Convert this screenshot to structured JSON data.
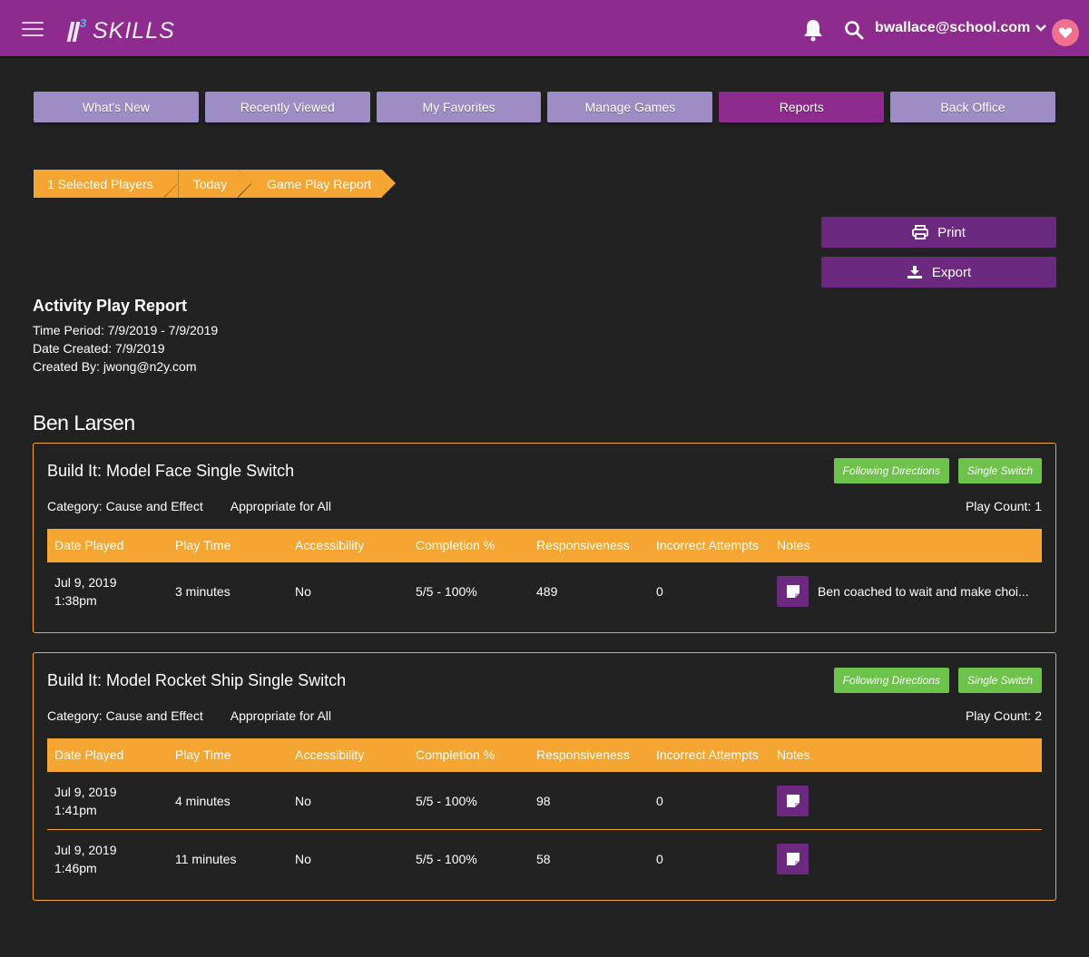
{
  "header": {
    "logo_superscript": "3",
    "logo_text": "SKILLS",
    "user_email": "bwallace@school.com",
    "icons": [
      "hamburger-menu-icon",
      "bell-icon",
      "search-icon",
      "chevron-down-icon",
      "heart-icon"
    ],
    "colors": {
      "topbar": "#8e2b8e",
      "heart": "#f07090"
    }
  },
  "nav": {
    "tabs": [
      {
        "label": "What's New"
      },
      {
        "label": "Recently Viewed"
      },
      {
        "label": "My Favorites"
      },
      {
        "label": "Manage Games"
      },
      {
        "label": "Reports",
        "active": true
      },
      {
        "label": "Back Office"
      }
    ],
    "colors": {
      "inactive": "#9e8cc4",
      "active": "#8e2b8e"
    }
  },
  "breadcrumb": [
    {
      "label": "1 Selected Players"
    },
    {
      "label": "Today"
    },
    {
      "label": "Game Play Report"
    }
  ],
  "actions": {
    "print_label": "Print",
    "export_label": "Export"
  },
  "report": {
    "title": "Activity Play Report",
    "time_period": "Time Period: 7/9/2019 - 7/9/2019",
    "date_created": "Date Created: 7/9/2019",
    "created_by": "Created By: jwong@n2y.com"
  },
  "student_name": "Ben Larsen",
  "table_headers": [
    "Date Played",
    "Play Time",
    "Accessibility",
    "Completion %",
    "Responsiveness",
    "Incorrect Attempts",
    "Notes"
  ],
  "games": [
    {
      "title": "Build It: Model Face Single Switch",
      "tags": [
        "Following Directions",
        "Single Switch"
      ],
      "category": "Category: Cause and Effect",
      "audience": "Appropriate for All",
      "play_count": "Play Count: 1",
      "rows": [
        {
          "date": "Jul 9, 2019",
          "time": "1:38pm",
          "play_time": "3 minutes",
          "accessibility": "No",
          "completion": "5/5 - 100%",
          "responsiveness": "489",
          "incorrect": "0",
          "note": "Ben coached to wait and make choi..."
        }
      ]
    },
    {
      "title": "Build It: Model Rocket Ship Single Switch",
      "tags": [
        "Following Directions",
        "Single Switch"
      ],
      "category": "Category: Cause and Effect",
      "audience": "Appropriate for All",
      "play_count": "Play Count: 2",
      "rows": [
        {
          "date": "Jul 9, 2019",
          "time": "1:41pm",
          "play_time": "4 minutes",
          "accessibility": "No",
          "completion": "5/5 - 100%",
          "responsiveness": "98",
          "incorrect": "0",
          "note": ""
        },
        {
          "date": "Jul 9, 2019",
          "time": "1:46pm",
          "play_time": "11 minutes",
          "accessibility": "No",
          "completion": "5/5 - 100%",
          "responsiveness": "58",
          "incorrect": "0",
          "note": ""
        }
      ]
    }
  ],
  "accent_colors": {
    "orange": "#f5a632",
    "green_tag": "#6cc24a",
    "purple_button": "#6b2a80"
  }
}
